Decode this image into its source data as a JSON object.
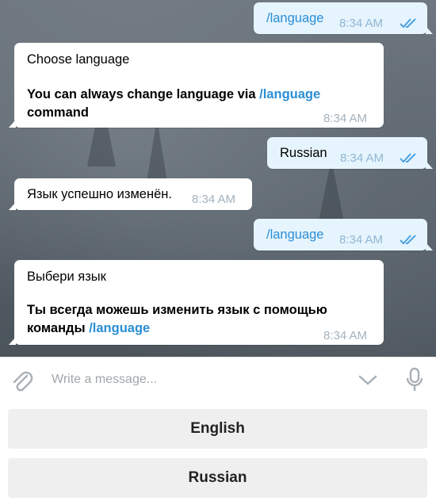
{
  "messages": [
    {
      "dir": "out",
      "text": "/language",
      "time": "8:34 AM"
    },
    {
      "dir": "in",
      "title": "Choose language",
      "body_prefix": "You can always change language via ",
      "body_link": "/language",
      "body_suffix": "command",
      "time": "8:34 AM"
    },
    {
      "dir": "out",
      "text": "Russian",
      "time": "8:34 AM"
    },
    {
      "dir": "in",
      "text": "Язык успешно изменён.",
      "time": "8:34 AM"
    },
    {
      "dir": "out",
      "text": "/language",
      "time": "8:34 AM"
    },
    {
      "dir": "in",
      "title": "Выбери язык",
      "body_prefix": "Ты всегда можешь изменить язык с помощью",
      "body_suffix_prefix": "команды ",
      "body_link": "/language",
      "time": "8:34 AM"
    }
  ],
  "composer": {
    "placeholder": "Write a message..."
  },
  "keyboard": [
    {
      "label": "English"
    },
    {
      "label": "Russian"
    }
  ],
  "icons": {
    "attach": "paperclip-icon",
    "chevron": "chevron-down-icon",
    "mic": "microphone-icon",
    "read": "double-check-icon"
  },
  "colors": {
    "link": "#2a8ed6",
    "outgoing_bubble": "#e6f4fd",
    "incoming_bubble": "#ffffff",
    "time": "#a5b2bc"
  }
}
